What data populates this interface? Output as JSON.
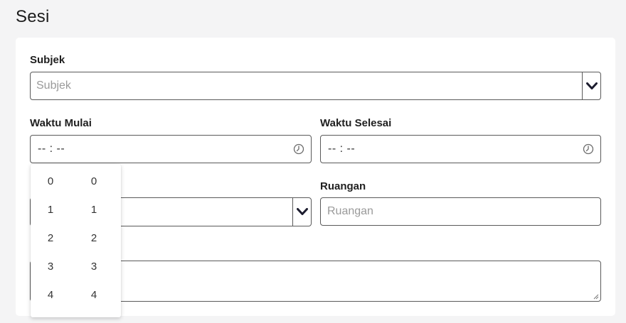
{
  "page": {
    "title": "Sesi"
  },
  "form": {
    "subjek": {
      "label": "Subjek",
      "placeholder": "Subjek"
    },
    "waktu_mulai": {
      "label": "Waktu Mulai",
      "value": "-- : --"
    },
    "waktu_selesai": {
      "label": "Waktu Selesai",
      "value": "-- : --"
    },
    "ruangan": {
      "label": "Ruangan",
      "placeholder": "Ruangan"
    }
  },
  "time_picker": {
    "hours": [
      "0",
      "1",
      "2",
      "3",
      "4"
    ],
    "minutes": [
      "0",
      "1",
      "2",
      "3",
      "4"
    ]
  },
  "icons": {
    "select_arrow": "chevron-down-icon",
    "time": "clock-icon"
  },
  "colors": {
    "background": "#f4f4f5",
    "card": "#ffffff",
    "border": "#5a5a5a"
  }
}
